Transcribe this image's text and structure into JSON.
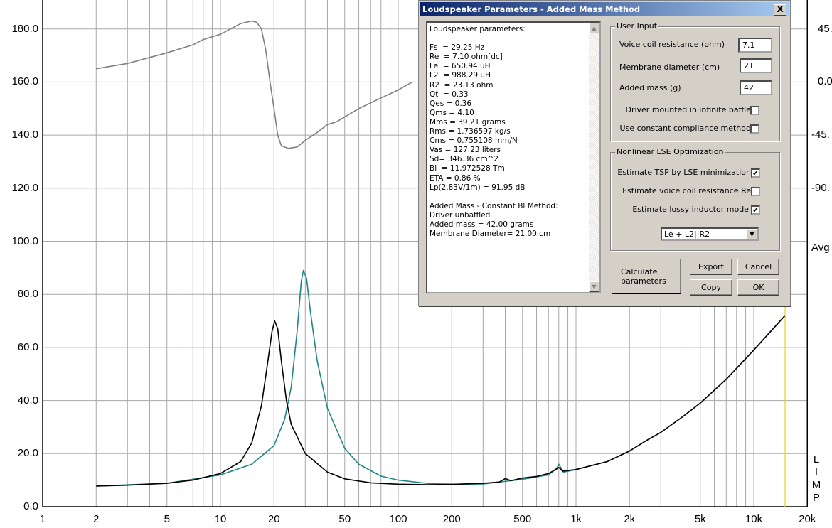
{
  "chart_data": {
    "type": "line",
    "title": "",
    "x_scale": "log",
    "xlim": [
      1,
      20000
    ],
    "ylim": [
      0,
      191
    ],
    "y2lim": [
      -90,
      45
    ],
    "grid": true,
    "x_ticks": [
      "1",
      "2",
      "5",
      "10",
      "20",
      "50",
      "100",
      "200",
      "500",
      "1k",
      "2k",
      "5k",
      "10k",
      "20k"
    ],
    "x_tick_values": [
      1,
      2,
      5,
      10,
      20,
      50,
      100,
      200,
      500,
      1000,
      2000,
      5000,
      10000,
      20000
    ],
    "y_ticks": [
      "0.0",
      "20.0",
      "40.0",
      "60.0",
      "80.0",
      "100.0",
      "120.0",
      "140.0",
      "160.0",
      "180.0"
    ],
    "y_tick_values": [
      0,
      20,
      40,
      60,
      80,
      100,
      120,
      140,
      160,
      180
    ],
    "y2_ticks": [
      "45.",
      "0.0",
      "-45.",
      "-90."
    ],
    "y2_tick_values": [
      45,
      0,
      -45,
      -90
    ],
    "y2_extra_label": "Avg",
    "axis_side_label": [
      "L",
      "I",
      "M",
      "P"
    ],
    "marker_frequency": 15000,
    "colors": {
      "measured": "#000000",
      "fitted": "#1f8585",
      "phase": "#808080",
      "marker": "#e8d21c",
      "grid": "#a8a8a8"
    },
    "series": [
      {
        "key": "measured",
        "axis": "left",
        "points": [
          [
            2,
            7.8
          ],
          [
            3,
            8.1
          ],
          [
            5,
            8.8
          ],
          [
            7,
            10
          ],
          [
            10,
            12.5
          ],
          [
            13,
            17
          ],
          [
            15,
            24
          ],
          [
            17,
            38
          ],
          [
            18.5,
            55
          ],
          [
            19.5,
            66
          ],
          [
            20.2,
            70
          ],
          [
            21,
            67
          ],
          [
            22,
            55
          ],
          [
            23.5,
            40
          ],
          [
            25,
            31
          ],
          [
            30,
            20
          ],
          [
            40,
            13
          ],
          [
            50,
            10.5
          ],
          [
            70,
            9
          ],
          [
            100,
            8.5
          ],
          [
            150,
            8.3
          ],
          [
            200,
            8.4
          ],
          [
            300,
            8.8
          ],
          [
            370,
            9.3
          ],
          [
            400,
            10.6
          ],
          [
            430,
            9.8
          ],
          [
            500,
            10.8
          ],
          [
            600,
            11.4
          ],
          [
            700,
            12.5
          ],
          [
            770,
            14
          ],
          [
            800,
            14.8
          ],
          [
            840,
            13.4
          ],
          [
            1000,
            14
          ],
          [
            1500,
            17
          ],
          [
            2000,
            21
          ],
          [
            2500,
            25
          ],
          [
            3000,
            28
          ],
          [
            4000,
            34
          ],
          [
            5000,
            39
          ],
          [
            7000,
            48
          ],
          [
            10000,
            59
          ],
          [
            15000,
            72
          ]
        ]
      },
      {
        "key": "fitted",
        "axis": "left",
        "points": [
          [
            2,
            7.8
          ],
          [
            5,
            8.8
          ],
          [
            10,
            12
          ],
          [
            15,
            16
          ],
          [
            20,
            23
          ],
          [
            23,
            33
          ],
          [
            25,
            45
          ],
          [
            27,
            66
          ],
          [
            28.5,
            85
          ],
          [
            29.3,
            89
          ],
          [
            30.5,
            86
          ],
          [
            32,
            74
          ],
          [
            35,
            55
          ],
          [
            40,
            37
          ],
          [
            50,
            22
          ],
          [
            60,
            16
          ],
          [
            80,
            11.5
          ],
          [
            100,
            10
          ],
          [
            150,
            8.7
          ],
          [
            200,
            8.5
          ],
          [
            300,
            8.6
          ],
          [
            500,
            10.3
          ],
          [
            700,
            12
          ],
          [
            780,
            14.5
          ],
          [
            800,
            16
          ],
          [
            850,
            13
          ],
          [
            1000,
            14
          ],
          [
            1500,
            17
          ],
          [
            2000,
            21
          ],
          [
            2500,
            25
          ],
          [
            3000,
            28
          ],
          [
            4000,
            34
          ],
          [
            5000,
            39
          ],
          [
            7000,
            48
          ],
          [
            10000,
            59
          ],
          [
            15000,
            72
          ]
        ]
      },
      {
        "key": "phase",
        "axis": "right",
        "points": [
          [
            2,
            11.25
          ],
          [
            3,
            15.75
          ],
          [
            5,
            24.75
          ],
          [
            7,
            31.5
          ],
          [
            8,
            36
          ],
          [
            10,
            40.5
          ],
          [
            13,
            49.5
          ],
          [
            15,
            51.75
          ],
          [
            16,
            50.6
          ],
          [
            17,
            45
          ],
          [
            18,
            27
          ],
          [
            19,
            0
          ],
          [
            20,
            -22.5
          ],
          [
            21,
            -45
          ],
          [
            22,
            -54
          ],
          [
            24,
            -56.25
          ],
          [
            27,
            -55.1
          ],
          [
            30,
            -49.5
          ],
          [
            35,
            -42.75
          ],
          [
            40,
            -36
          ],
          [
            45,
            -33.75
          ],
          [
            60,
            -22.5
          ],
          [
            80,
            -13.5
          ],
          [
            100,
            -6.75
          ],
          [
            120,
            0
          ]
        ]
      }
    ]
  },
  "dialog": {
    "title": "Loudspeaker Parameters - Added Mass Method",
    "close_label": "X",
    "results_lines": [
      "Loudspeaker parameters:",
      "",
      "Fs  = 29.25 Hz",
      "Re  = 7.10 ohm[dc]",
      "Le  = 650.94 uH",
      "L2  = 988.29 uH",
      "R2  = 23.13 ohm",
      "Qt  = 0.33",
      "Qes = 0.36",
      "Qms = 4.10",
      "Mms = 39.21 grams",
      "Rms = 1.736597 kg/s",
      "Cms = 0.755108 mm/N",
      "Vas = 127.23 liters",
      "Sd= 346.36 cm^2",
      "Bl  = 11.972528 Tm",
      "ETA = 0.86 %",
      "Lp(2.83V/1m) = 91.95 dB",
      "",
      "Added Mass - Constant Bl Method:",
      "Driver unbaffled",
      "Added mass = 42.00 grams",
      "Membrane Diameter= 21.00 cm"
    ],
    "user_input": {
      "label": "User Input",
      "voice_coil_label": "Voice coil resistance (ohm)",
      "voice_coil_value": "7.1",
      "membrane_label": "Membrane diameter (cm)",
      "membrane_value": "21",
      "added_mass_label": "Added mass (g)",
      "added_mass_value": "42",
      "infinite_baffle_label": "Driver mounted in infinite baffle",
      "infinite_baffle_checked": false,
      "constant_compliance_label": "Use constant compliance method",
      "constant_compliance_checked": false
    },
    "lse": {
      "label": "Nonlinear LSE Optimization",
      "estimate_tsp_label": "Estimate TSP by LSE minimization",
      "estimate_tsp_checked": true,
      "estimate_re_label": "Estimate voice coil resistance Re",
      "estimate_re_checked": false,
      "lossy_inductor_label": "Estimate lossy inductor model",
      "lossy_inductor_checked": true,
      "model_selected": "Le + L2||R2"
    },
    "buttons": {
      "calculate": "Calculate parameters",
      "export": "Export",
      "cancel": "Cancel",
      "copy": "Copy",
      "ok": "OK"
    }
  }
}
